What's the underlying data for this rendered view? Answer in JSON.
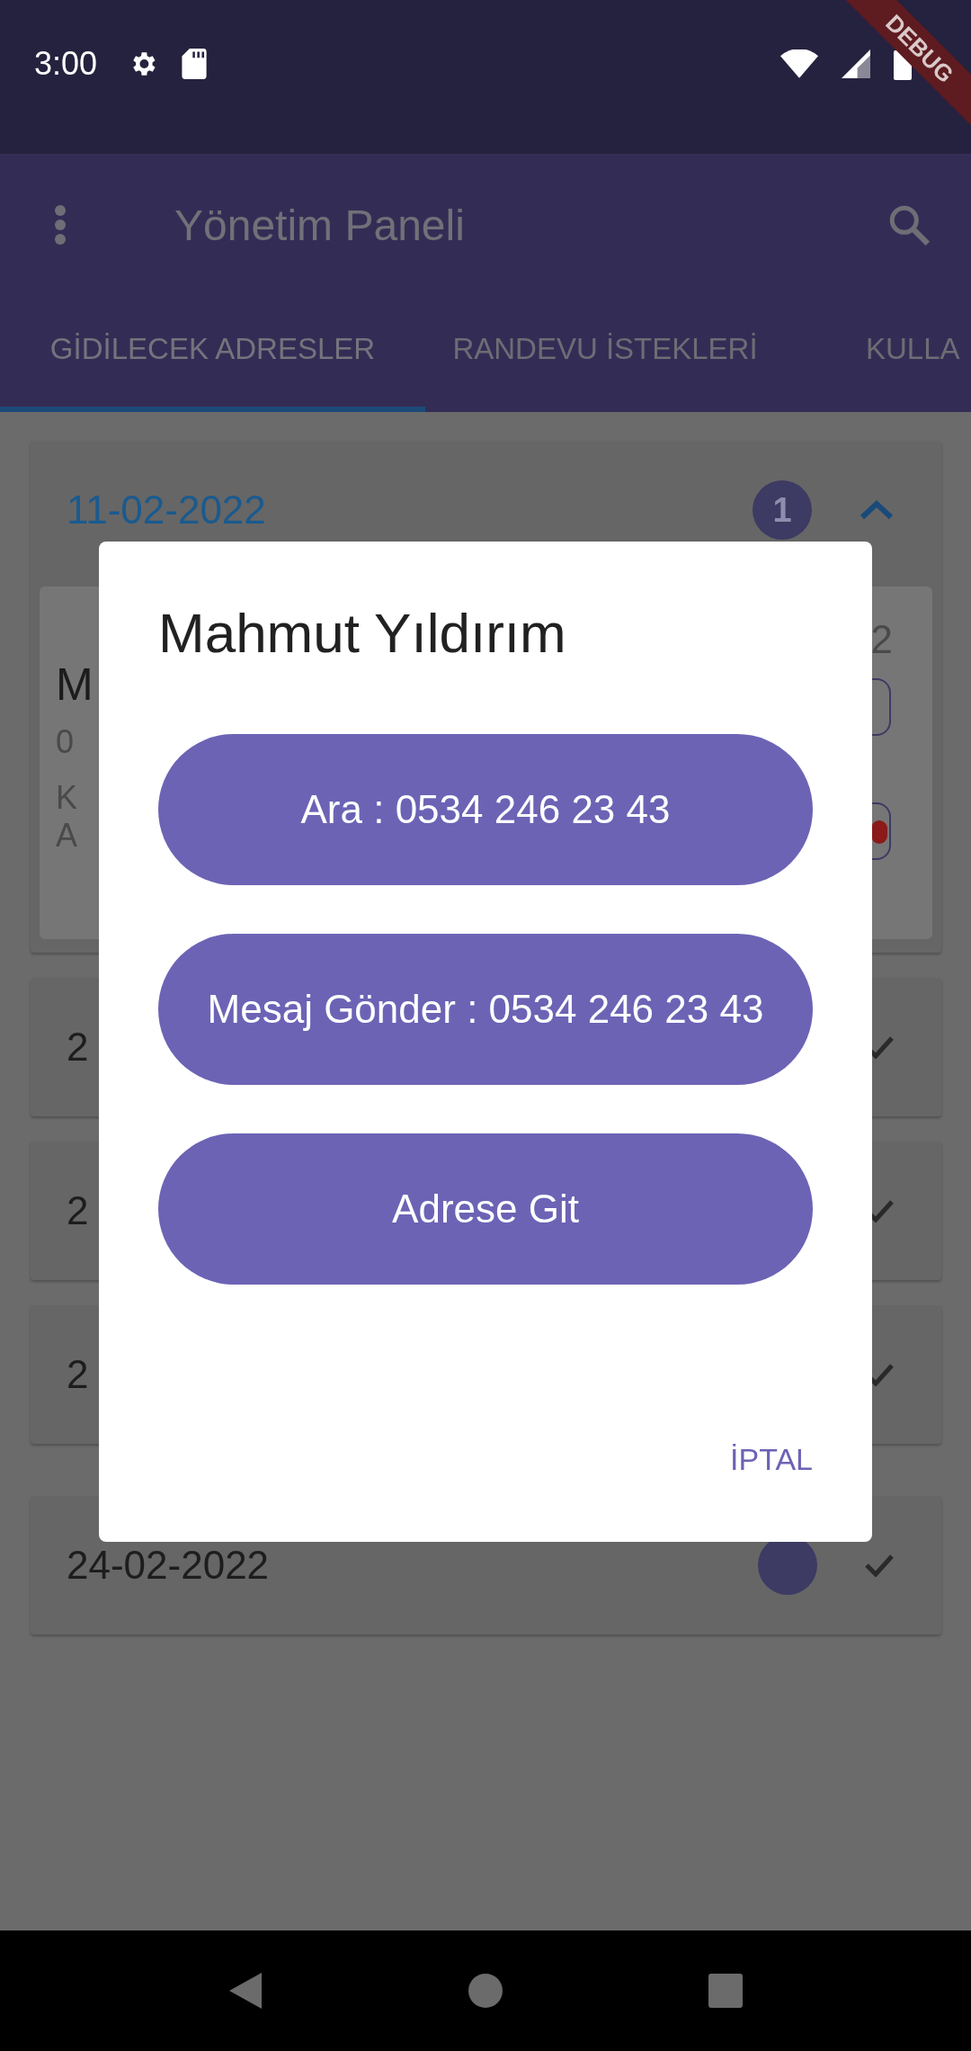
{
  "status_bar": {
    "time": "3:00"
  },
  "debug_banner": "DEBUG",
  "app_bar": {
    "title": "Yönetim Paneli"
  },
  "tabs": [
    {
      "label": "GİDİLECEK ADRESLER",
      "selected": true
    },
    {
      "label": "RANDEVU İSTEKLERİ",
      "selected": false
    },
    {
      "label": "KULLA",
      "selected": false
    }
  ],
  "date_groups": [
    {
      "date": "11-02-2022",
      "badge": true,
      "count": "1",
      "expanded": true,
      "entry": {
        "name": "M",
        "time": "2",
        "phone": "0",
        "address_lines": [
          "K",
          "A"
        ]
      }
    },
    {
      "date": "2",
      "expanded": false
    },
    {
      "date": "2",
      "expanded": false
    },
    {
      "date": "2",
      "expanded": false
    },
    {
      "date": "24-02-2022",
      "badge": true,
      "expanded": false
    }
  ],
  "dialog": {
    "title": "Mahmut Yıldırım",
    "actions": [
      "Ara : 0534 246 23 43",
      "Mesaj Gönder : 0534 246 23 43",
      "Adrese Git"
    ],
    "cancel": "İPTAL"
  }
}
